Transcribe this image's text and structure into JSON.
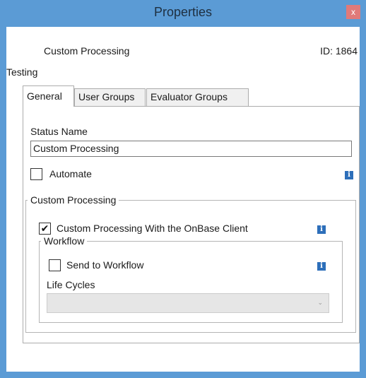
{
  "window": {
    "title": "Properties",
    "close_label": "x"
  },
  "header": {
    "name": "Custom Processing",
    "id_text": "ID: 1864"
  },
  "group_name": "Testing",
  "tabs": [
    {
      "label": "General",
      "active": true
    },
    {
      "label": "User Groups",
      "active": false
    },
    {
      "label": "Evaluator Groups",
      "active": false
    }
  ],
  "general": {
    "status_name_label": "Status Name",
    "status_name_value": "Custom Processing",
    "automate_label": "Automate",
    "automate_checked": false,
    "custom_processing_group": {
      "legend": "Custom Processing",
      "onbase_label": "Custom Processing With the OnBase Client",
      "onbase_checked": true,
      "workflow_group": {
        "legend": "Workflow",
        "send_label": "Send to Workflow",
        "send_checked": false,
        "life_cycles_label": "Life Cycles",
        "life_cycles_value": ""
      }
    }
  },
  "icons": {
    "info": "info-icon",
    "check": "checkmark-icon",
    "dropdown": "chevron-down-icon"
  },
  "colors": {
    "titlebar": "#5b9bd5",
    "close_button": "#e07a7a",
    "info_icon": "#2d6fba",
    "disabled_combo": "#e6e6e6"
  }
}
